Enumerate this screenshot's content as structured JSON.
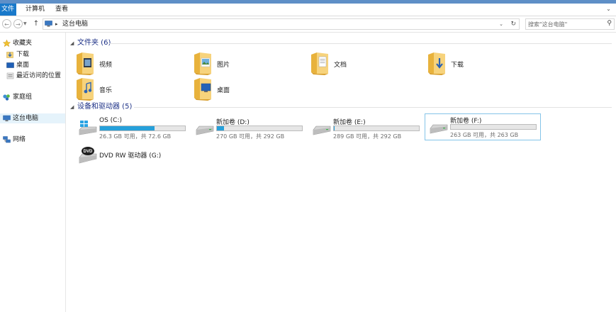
{
  "ribbon": {
    "tabs": [
      "文件",
      "计算机",
      "查看"
    ]
  },
  "address": {
    "location": "这台电脑",
    "separator": "▸",
    "search_placeholder": "搜索\"这台电脑\""
  },
  "nav": {
    "favorites": "收藏夹",
    "downloads": "下载",
    "desktop": "桌面",
    "recent": "最近访问的位置",
    "homegroup": "家庭组",
    "this_pc": "这台电脑",
    "network": "网络"
  },
  "folders": {
    "header": "文件夹 (6)",
    "items": [
      {
        "name": "视频",
        "icon": "videos-folder-icon"
      },
      {
        "name": "图片",
        "icon": "pictures-folder-icon"
      },
      {
        "name": "文档",
        "icon": "documents-folder-icon"
      },
      {
        "name": "下载",
        "icon": "downloads-folder-icon"
      },
      {
        "name": "音乐",
        "icon": "music-folder-icon"
      },
      {
        "name": "桌面",
        "icon": "desktop-folder-icon"
      }
    ]
  },
  "drives": {
    "header": "设备和驱动器 (5)",
    "items": [
      {
        "name": "OS (C:)",
        "info": "26.3 GB 可用，共 72.6 GB",
        "used_fraction": 0.64
      },
      {
        "name": "新加卷 (D:)",
        "info": "270 GB 可用，共 292 GB",
        "used_fraction": 0.08
      },
      {
        "name": "新加卷 (E:)",
        "info": "289 GB 可用，共 292 GB",
        "used_fraction": 0.01
      },
      {
        "name": "新加卷 (F:)",
        "info": "263 GB 可用，共 263 GB",
        "used_fraction": 0.0
      }
    ],
    "dvd": {
      "name": "DVD RW 驱动器 (G:)",
      "badge": "DVD"
    }
  },
  "colors": {
    "accent": "#1979ca",
    "drive_bar": "#26a0da",
    "group_title": "#1e3287"
  }
}
